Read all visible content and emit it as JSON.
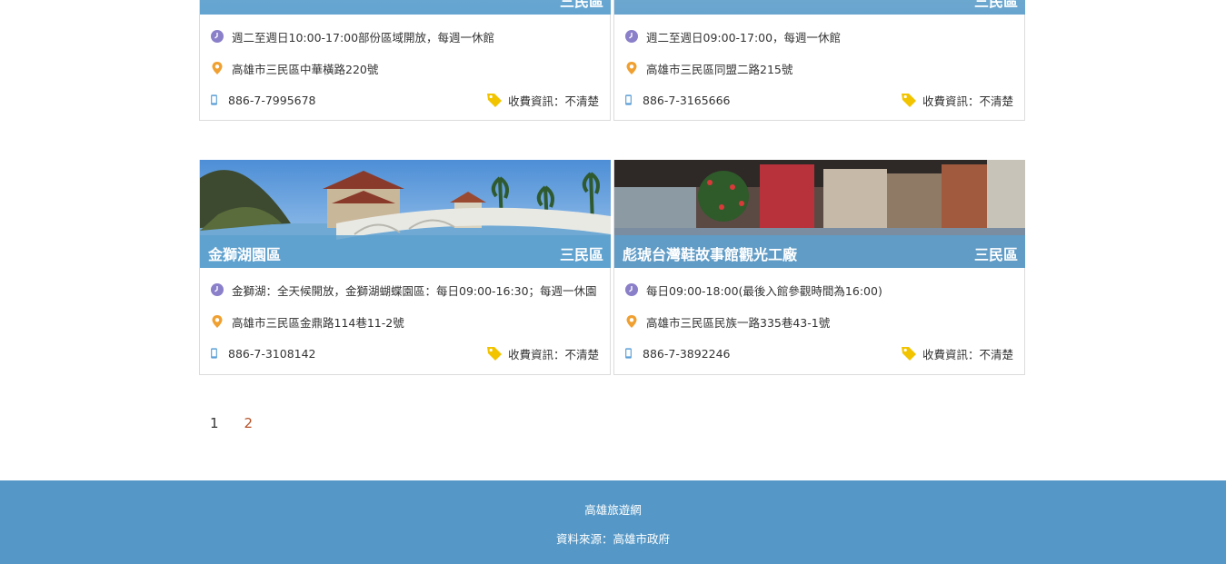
{
  "cards": [
    {
      "name": "",
      "district": "三民區",
      "hours": "週二至週日10:00-17:00部份區域開放，每週一休館",
      "address": "高雄市三民區中華橫路220號",
      "phone": "886-7-7995678",
      "fee": "收費資訊：不清楚"
    },
    {
      "name": "",
      "district": "三民區",
      "hours": "週二至週日09:00-17:00，每週一休館",
      "address": "高雄市三民區同盟二路215號",
      "phone": "886-7-3165666",
      "fee": "收費資訊：不清楚"
    },
    {
      "name": "金獅湖園區",
      "district": "三民區",
      "hours": "金獅湖：全天候開放，金獅湖蝴蝶園區：每日09:00-16:30；每週一休園",
      "address": "高雄市三民區金鼎路114巷11-2號",
      "phone": "886-7-3108142",
      "fee": "收費資訊：不清楚"
    },
    {
      "name": "彪琥台灣鞋故事館觀光工廠",
      "district": "三民區",
      "hours": "每日09:00-18:00(最後入館參觀時間為16:00)",
      "address": "高雄市三民區民族一路335巷43-1號",
      "phone": "886-7-3892246",
      "fee": "收費資訊：不清楚"
    }
  ],
  "pagination": {
    "current": "1",
    "next": "2"
  },
  "footer": {
    "title": "高雄旅遊網",
    "source": "資料來源：高雄市政府"
  },
  "colors": {
    "caption": "#5ba0ce",
    "clock": "#8a7fc9",
    "pin": "#f0a030",
    "phone": "#5a9ed6",
    "tag": "#f2c400",
    "footer": "#5598c7",
    "page_active": "#333333",
    "page_link": "#b5532a"
  },
  "icons": {
    "hours": "clock-icon",
    "address": "map-pin-icon",
    "phone": "phone-icon",
    "fee": "tag-icon"
  }
}
